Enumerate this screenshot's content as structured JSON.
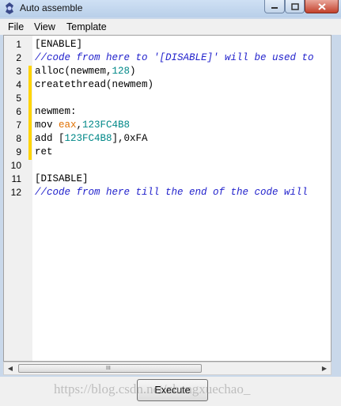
{
  "window": {
    "title": "Auto assemble",
    "controls": {
      "minimize": "minimize-icon",
      "maximize": "maximize-icon",
      "close": "close-icon"
    }
  },
  "menu": [
    "File",
    "View",
    "Template"
  ],
  "editor": {
    "line_numbers": [
      "1",
      "2",
      "3",
      "4",
      "5",
      "6",
      "7",
      "8",
      "9",
      "10",
      "11",
      "12"
    ],
    "lines": [
      [
        {
          "t": "[ENABLE]",
          "c": "plain"
        }
      ],
      [
        {
          "t": "//code from here to '[DISABLE]' will be used to",
          "c": "comment"
        }
      ],
      [
        {
          "t": "alloc(newmem,",
          "c": "plain"
        },
        {
          "t": "128",
          "c": "num"
        },
        {
          "t": ")",
          "c": "plain"
        }
      ],
      [
        {
          "t": "createthread(newmem)",
          "c": "plain"
        }
      ],
      [],
      [
        {
          "t": "newmem:",
          "c": "plain"
        }
      ],
      [
        {
          "t": "mov ",
          "c": "plain"
        },
        {
          "t": "eax",
          "c": "reg"
        },
        {
          "t": ",",
          "c": "plain"
        },
        {
          "t": "123FC4B8",
          "c": "num"
        }
      ],
      [
        {
          "t": "add [",
          "c": "plain"
        },
        {
          "t": "123FC4B8",
          "c": "num"
        },
        {
          "t": "],0xFA",
          "c": "plain"
        }
      ],
      [
        {
          "t": "ret",
          "c": "plain"
        }
      ],
      [],
      [
        {
          "t": "[DISABLE]",
          "c": "plain"
        }
      ],
      [
        {
          "t": "//code from here till the end of the code will",
          "c": "comment"
        }
      ]
    ],
    "modified_lines": [
      3,
      4,
      5,
      6,
      7,
      8,
      9
    ]
  },
  "scrollbar": {
    "grip": "III"
  },
  "footer": {
    "execute_label": "Execute"
  },
  "watermark": "https://blog.csdn.net/zhangxuechao_"
}
